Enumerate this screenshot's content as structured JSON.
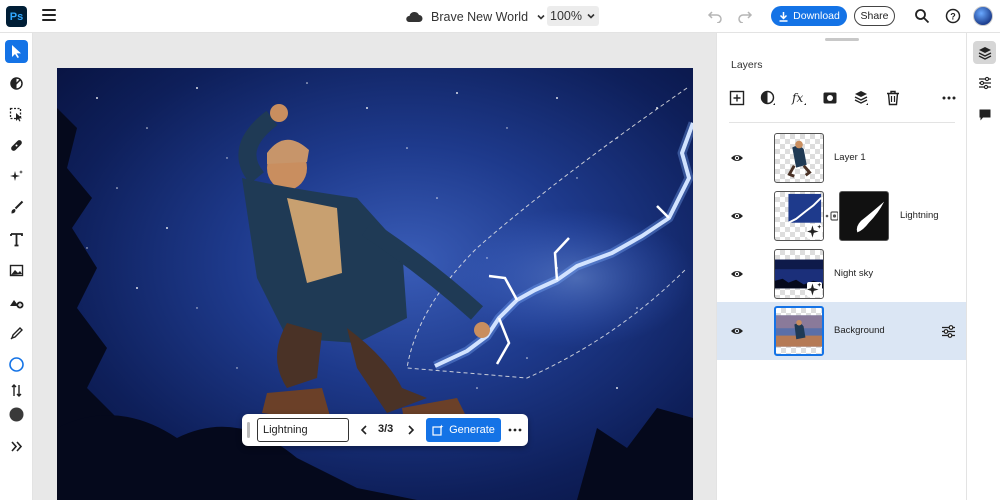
{
  "app": {
    "logo": "Ps"
  },
  "document": {
    "title": "Brave New World",
    "zoom": "100%"
  },
  "header": {
    "download_label": "Download",
    "share_label": "Share"
  },
  "generate_bar": {
    "prompt_value": "Lightning",
    "counter": "3/3",
    "generate_label": "Generate"
  },
  "layers_panel": {
    "title": "Layers",
    "layers": [
      {
        "name": "Layer 1"
      },
      {
        "name": "Lightning"
      },
      {
        "name": "Night sky"
      },
      {
        "name": "Background"
      }
    ]
  },
  "colors": {
    "accent": "#1473e6",
    "selected_row": "#dbe6f4",
    "sky": "#1e3a8c"
  }
}
